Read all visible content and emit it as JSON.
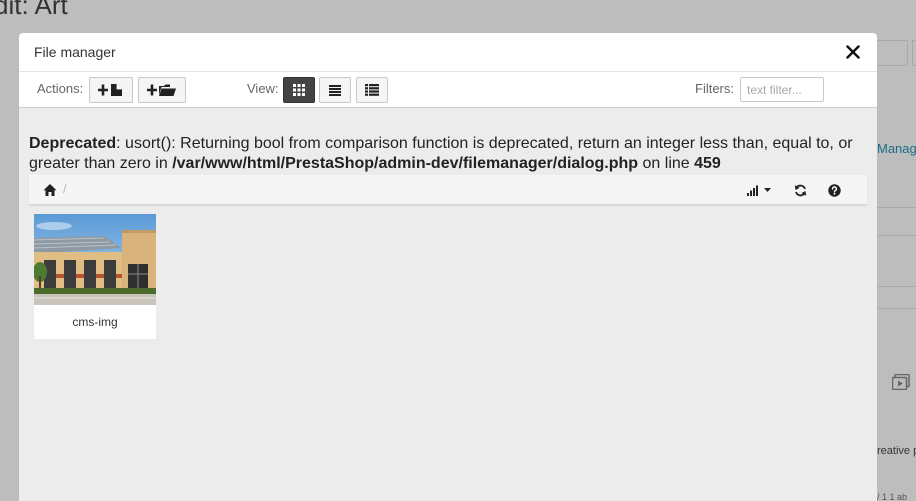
{
  "background": {
    "page_title": "dit: Art",
    "side_link": "Manag",
    "side_text": "reative p",
    "side_small": "/ 1 1 ab"
  },
  "modal": {
    "title": "File manager",
    "close_symbol": "✕"
  },
  "toolbar": {
    "actions_label": "Actions:",
    "view_label": "View:",
    "filters_label": "Filters:",
    "filter_placeholder": "text filter...",
    "action_buttons": [
      "upload-file-icon",
      "new-folder-icon"
    ],
    "view_buttons": [
      "grid-view-icon",
      "list-view-icon",
      "columns-view-icon"
    ],
    "active_view": "grid"
  },
  "error": {
    "level": "Deprecated",
    "message": ": usort(): Returning bool from comparison function is deprecated, return an integer less than, equal to, or greater than zero in ",
    "path": "/var/www/html/PrestaShop/admin-dev/filemanager/dialog.php",
    "on_line_text": " on line ",
    "line": "459"
  },
  "breadcrumb": {
    "separator": "/",
    "icons": [
      "home-icon",
      "sort-icon",
      "refresh-icon",
      "help-icon"
    ]
  },
  "files": [
    {
      "name": "cms-img"
    }
  ],
  "colors": {
    "overlay_bg": "#bdbdbd",
    "modal_body": "#ececec",
    "active_button": "#444444",
    "link": "#1c6d8a"
  }
}
